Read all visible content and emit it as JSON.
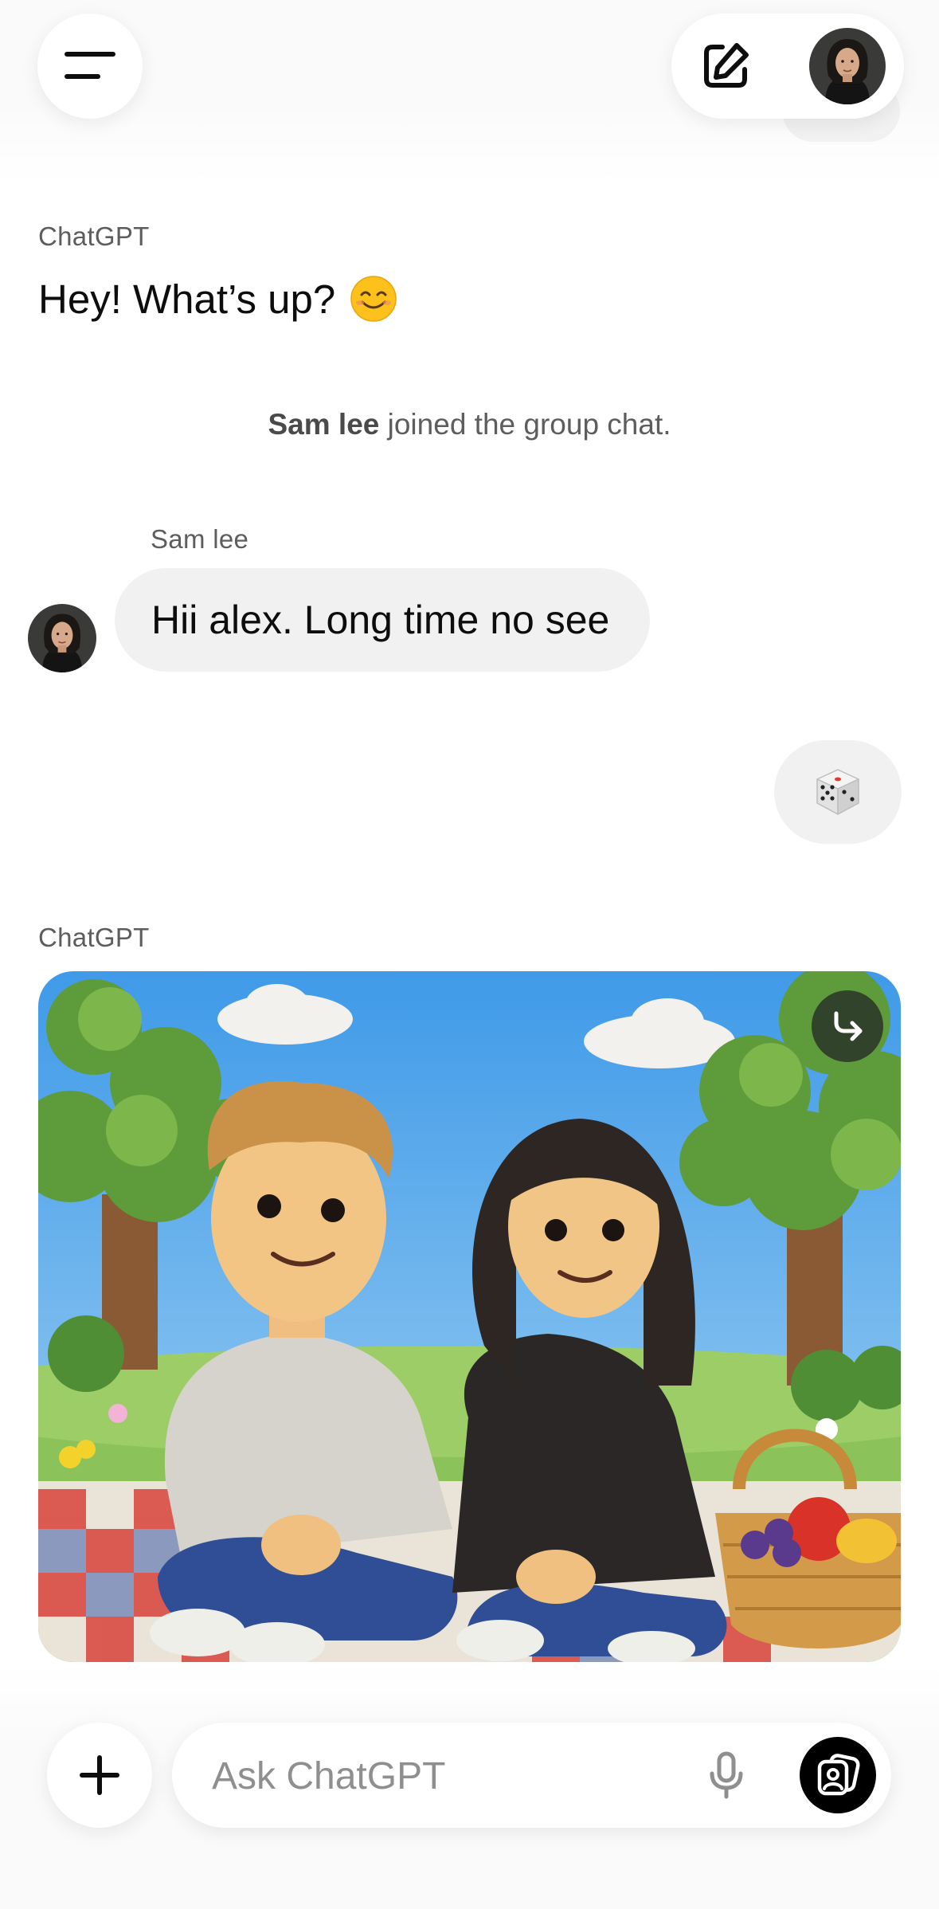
{
  "header": {
    "menu_icon": "menu-icon",
    "compose_icon": "compose-icon",
    "profile_avatar": "avatar"
  },
  "messages": [
    {
      "type": "assistant",
      "sender": "ChatGPT",
      "text": "Hey! What’s up?",
      "emoji": "smiling-face-emoji"
    },
    {
      "type": "system",
      "name": "Sam lee",
      "text": " joined the group chat."
    },
    {
      "type": "user",
      "sender": "Sam lee",
      "text": "Hii alex. Long time no see"
    },
    {
      "type": "self",
      "content_icon": "dice-icon"
    },
    {
      "type": "assistant-image",
      "sender": "ChatGPT",
      "action_icon": "share-arrow-icon"
    }
  ],
  "composer": {
    "placeholder": "Ask ChatGPT",
    "value": "",
    "plus_icon": "plus-icon",
    "mic_icon": "microphone-icon",
    "voice_icon": "voice-mode-icon"
  },
  "colors": {
    "bubble": "#f1f1f1",
    "secondary_text": "#5d5d5d",
    "primary_text": "#0d0d0d",
    "voice_button": "#000000"
  }
}
